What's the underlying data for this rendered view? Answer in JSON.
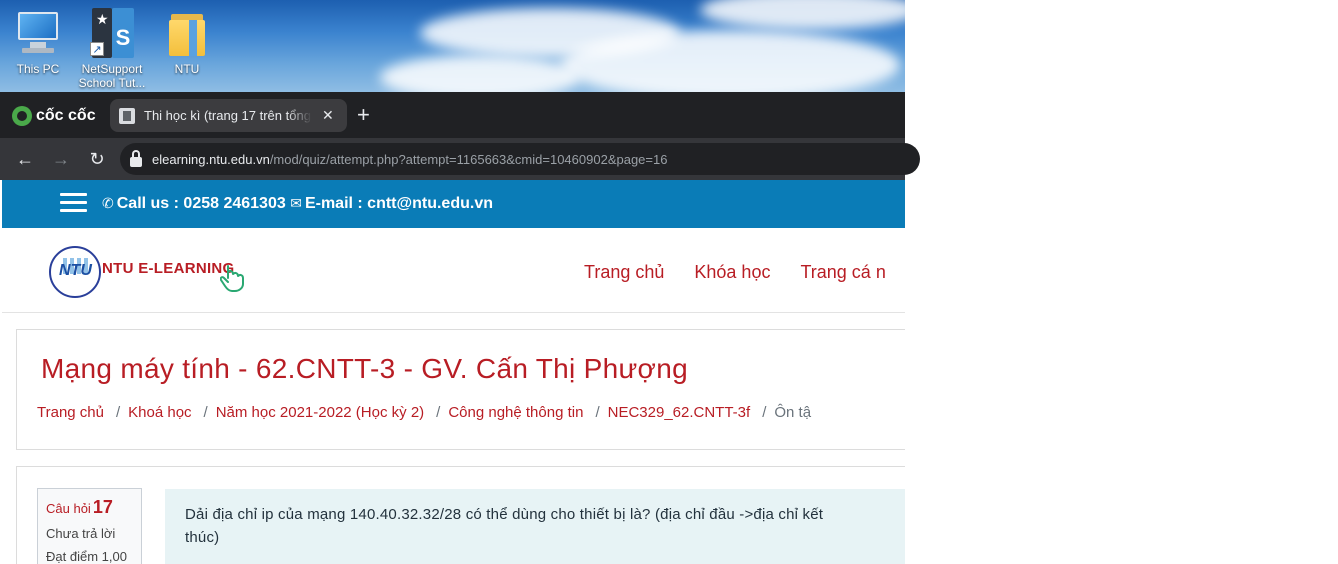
{
  "desktop": {
    "icons": [
      {
        "label": "This PC"
      },
      {
        "label": "NetSupport School Tut..."
      },
      {
        "label": "NTU"
      }
    ]
  },
  "browser": {
    "brand": "cốc cốc",
    "tab": {
      "title": "Thi học kì (trang 17 trên tổng"
    },
    "url_host": "elearning.ntu.edu.vn",
    "url_path": "/mod/quiz/attempt.php?attempt=1165663&cmid=10460902&page=16"
  },
  "site": {
    "topbar": {
      "phone": "Call us : 0258 2461303",
      "email": "E-mail : cntt@ntu.edu.vn"
    },
    "logo_text": "NTU",
    "brand_name": "NTU E-LEARNING",
    "nav": [
      "Trang chủ",
      "Khóa học",
      "Trang cá n"
    ]
  },
  "course": {
    "title": "Mạng máy tính - 62.CNTT-3 - GV. Cấn Thị Phượng",
    "breadcrumb": [
      "Trang chủ",
      "Khoá học",
      "Năm học 2021-2022 (Học kỳ 2)",
      "Công nghệ thông tin",
      "NEC329_62.CNTT-3f"
    ],
    "breadcrumb_current": "Ôn tậ"
  },
  "question": {
    "label": "Câu hỏi",
    "number": "17",
    "state": "Chưa trả lời",
    "grade": "Đạt điểm 1,00",
    "text_line1": "Dải địa chỉ ip của mạng 140.40.32.32/28 có thể dùng cho thiết bị là? (địa chỉ đầu ->địa chỉ kết",
    "text_line2": "thúc)"
  },
  "colors": {
    "brand_red": "#b81d24",
    "topbar_blue": "#0a7cb7",
    "question_bg": "#e7f3f5"
  }
}
